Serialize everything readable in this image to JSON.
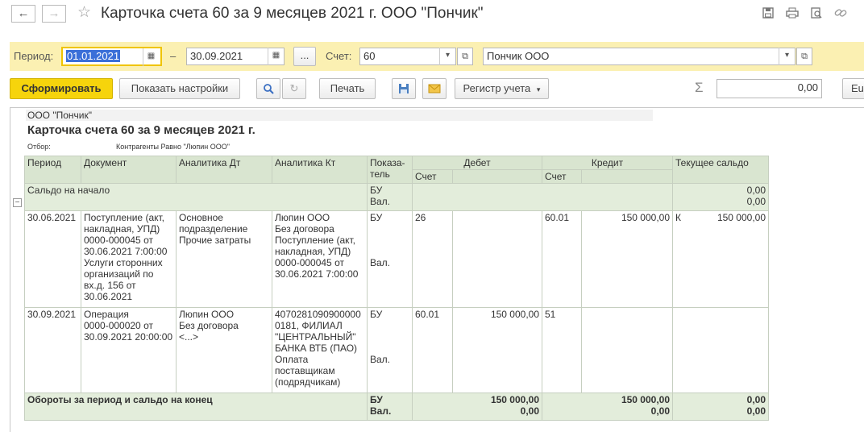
{
  "window": {
    "title": "Карточка счета 60 за 9 месяцев 2021 г. ООО \"Пончик\"",
    "back_glyph": "←",
    "forward_glyph": "→",
    "star_glyph": "☆",
    "icons": [
      "save-icon",
      "print-icon",
      "preview-icon",
      "link-icon"
    ]
  },
  "filter": {
    "period_label": "Период:",
    "date_from": "01.01.2021",
    "dash": "–",
    "date_to": "30.09.2021",
    "more_label": "...",
    "account_label": "Счет:",
    "account_value": "60",
    "org_value": "Пончик ООО",
    "accent": "#fbf0b2"
  },
  "toolbar": {
    "generate_label": "Сформировать",
    "settings_label": "Показать настройки",
    "print_label": "Печать",
    "register_label": "Регистр учета",
    "sum_value": "0,00",
    "sigma": "Σ",
    "cut_label": "Eu"
  },
  "report": {
    "org": "ООО \"Пончик\"",
    "title": "Карточка счета 60 за 9 месяцев 2021 г.",
    "filter_label": "Отбор:",
    "filter_value": "Контрагенты Равно \"Люпин ООО\"",
    "headers": {
      "period": "Период",
      "document": "Документ",
      "analytics_dt": "Аналитика Дт",
      "analytics_kt": "Аналитика Кт",
      "indicator": "Показа-\nтель",
      "debit": "Дебет",
      "credit": "Кредит",
      "balance": "Текущее сальдо",
      "account": "Счет"
    },
    "opening": {
      "label": "Сальдо на начало",
      "ind": "БУ\nВал.",
      "balance": "0,00\n0,00"
    },
    "rows": [
      {
        "period": "30.06.2021",
        "document": "Поступление (акт,\nнакладная, УПД)\n0000-000045 от\n30.06.2021 7:00:00\nУслуги сторонних\nорганизаций по\nвх.д. 156 от\n30.06.2021",
        "analytics_dt": "Основное\nподразделение\nПрочие затраты",
        "analytics_kt": "Люпин ООО\nБез договора\nПоступление (акт,\nнакладная, УПД)\n0000-000045 от\n30.06.2021 7:00:00",
        "ind": "БУ\n\n\n\nВал.",
        "debit_account": "26",
        "debit_amount": "",
        "credit_account": "60.01",
        "credit_amount": "150 000,00",
        "balance_side": "К",
        "balance_amount": "150 000,00"
      },
      {
        "period": "30.09.2021",
        "document": "Операция\n0000-000020 от\n30.09.2021 20:00:00",
        "analytics_dt": "Люпин ООО\nБез договора\n<...>",
        "analytics_kt": "4070281090900000\n0181, ФИЛИАЛ\n\"ЦЕНТРАЛЬНЫЙ\"\nБАНКА ВТБ (ПАО)\nОплата\nпоставщикам\n(подрядчикам)",
        "ind": "БУ\n\n\n\nВал.",
        "debit_account": "60.01",
        "debit_amount": "150 000,00",
        "credit_account": "51",
        "credit_amount": "",
        "balance_side": "",
        "balance_amount": ""
      }
    ],
    "totals": {
      "label": "Обороты за период и сальдо на конец",
      "ind": "БУ\nВал.",
      "debit": "150 000,00\n0,00",
      "credit": "150 000,00\n0,00",
      "balance": "0,00\n0,00"
    },
    "collapse_glyph": "−"
  }
}
